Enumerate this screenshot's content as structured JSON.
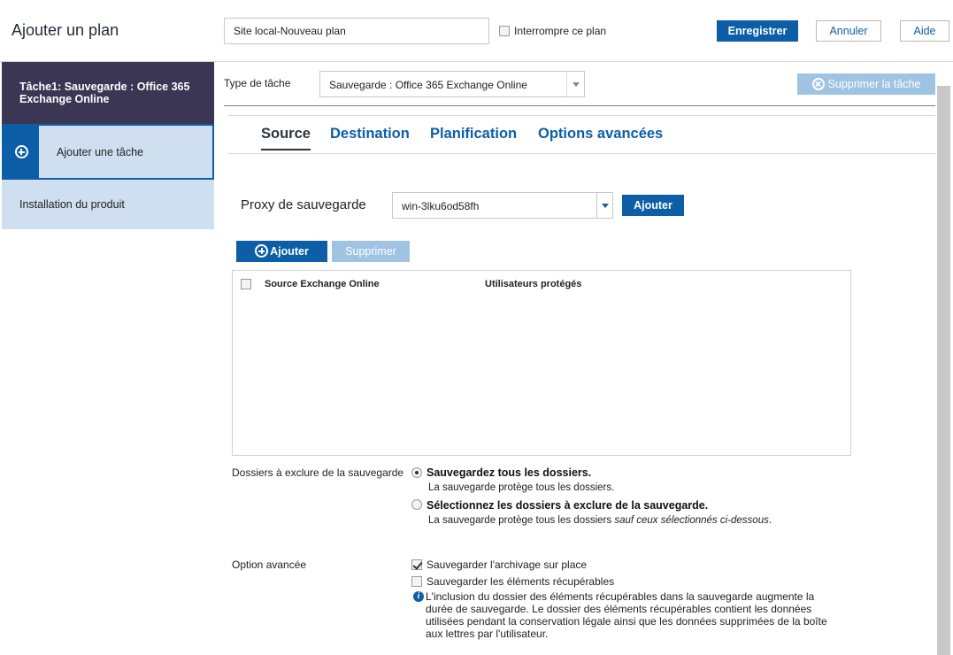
{
  "header": {
    "title": "Ajouter un plan",
    "plan_name_value": "Site local-Nouveau plan",
    "pause_label": "Interrompre ce plan",
    "save_label": "Enregistrer",
    "cancel_label": "Annuler",
    "help_label": "Aide"
  },
  "sidebar": {
    "task_label": "Tâche1: Sauvegarde : Office 365 Exchange Online",
    "add_task_label": "Ajouter une tâche",
    "install_label": "Installation du produit",
    "add_icon": "plus-circle-icon"
  },
  "task": {
    "type_label": "Type de tâche",
    "type_value": "Sauvegarde : Office 365 Exchange Online",
    "delete_label": "Supprimer la tâche",
    "delete_icon": "x-circle-icon"
  },
  "tabs": [
    "Source",
    "Destination",
    "Planification",
    "Options avancées"
  ],
  "source": {
    "proxy_label": "Proxy de sauvegarde",
    "proxy_value": "win-3lku6od58fh",
    "proxy_add_label": "Ajouter",
    "add_label": "Ajouter",
    "remove_label": "Supprimer",
    "columns": [
      "Source Exchange Online",
      "Utilisateurs protégés"
    ],
    "rows": []
  },
  "exclusions": {
    "label": "Dossiers à exclure de la sauvegarde",
    "option1_title": "Sauvegardez tous les dossiers.",
    "option1_desc": "La sauvegarde protège tous les dossiers.",
    "option2_title": "Sélectionnez les dossiers à exclure de la sauvegarde.",
    "option2_desc": "La sauvegarde protège tous les dossiers ",
    "option2_desc_italic": "sauf ceux sélectionnés ci-dessous",
    "option2_desc_end": "."
  },
  "advanced": {
    "label": "Option avancée",
    "archive_label": "Sauvegarder l'archivage sur place",
    "recoverable_label": "Sauvegarder les éléments récupérables",
    "info_text": "L'inclusion du dossier des éléments récupérables dans la sauvegarde augmente la durée de sauvegarde. Le dossier des éléments récupérables contient les données utilisées pendant la conservation légale ainsi que les données supprimées de la boîte aux lettres par l'utilisateur."
  },
  "colors": {
    "primary": "#0c5ea7",
    "sidebar_dark": "#3b3654",
    "sidebar_light": "#cfdff0",
    "disabled": "#9fc3e3"
  }
}
